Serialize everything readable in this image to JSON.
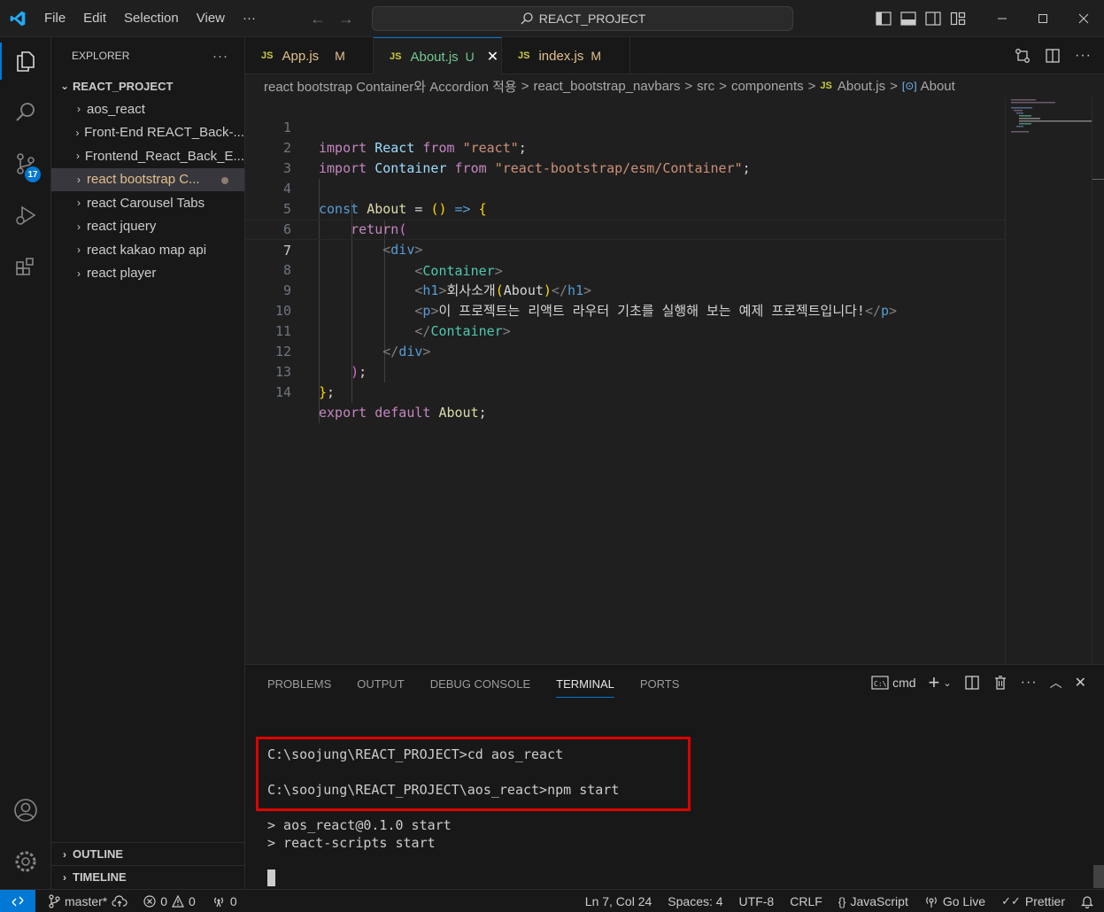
{
  "menu": [
    "File",
    "Edit",
    "Selection",
    "View",
    "···"
  ],
  "command_center": {
    "label": "REACT_PROJECT"
  },
  "explorer": {
    "header": "EXPLORER",
    "more": "···",
    "root": "REACT_PROJECT",
    "items": [
      {
        "label": "aos_react"
      },
      {
        "label": "Front-End REACT_Back-..."
      },
      {
        "label": "Frontend_React_Back_E..."
      },
      {
        "label": "react bootstrap C..."
      },
      {
        "label": "react Carousel Tabs"
      },
      {
        "label": "react jquery"
      },
      {
        "label": "react kakao map api"
      },
      {
        "label": "react player"
      }
    ],
    "outline": "OUTLINE",
    "timeline": "TIMELINE"
  },
  "activity": {
    "scm_badge": "17"
  },
  "tabs": [
    {
      "icon": "JS",
      "label": "App.js",
      "status": "M"
    },
    {
      "icon": "JS",
      "label": "About.js",
      "status": "U"
    },
    {
      "icon": "JS",
      "label": "index.js",
      "status": "M"
    }
  ],
  "breadcrumb": {
    "parts": [
      "react bootstrap Container와 Accordion 적용",
      "react_bootstrap_navbars",
      "src",
      "components"
    ],
    "file_icon": "JS",
    "file": "About.js",
    "symbol": "About",
    "separator": ">"
  },
  "editor": {
    "line_numbers": [
      "1",
      "2",
      "3",
      "4",
      "5",
      "6",
      "7",
      "8",
      "9",
      "10",
      "11",
      "12",
      "13",
      "14"
    ],
    "tokens": {
      "import": "import",
      "from": "from",
      "const": "const",
      "return": "return",
      "export": "export",
      "default": "default",
      "react": "React",
      "react_str": "\"react\"",
      "container": "Container",
      "container_str": "\"react-bootstrap/esm/Container\"",
      "about": "About",
      "eq": " = ",
      "parens": "()",
      "arrow": " => ",
      "lbrace": "{",
      "rbrace": "}",
      "semi": ";",
      "lparen": "(",
      "rparen": ")",
      "div": "div",
      "h1": "h1",
      "p": "p",
      "lt": "<",
      "gt": ">",
      "lt_slash": "</",
      "h1_text": "회사소개",
      "h1_paren_open": "(",
      "h1_about": "About",
      "h1_paren_close": ")",
      "p_text": "이 프로젝트는 리액트 라우터 기초를 실행해 보는 예제 프로젝트입니다!"
    }
  },
  "panel": {
    "tabs": [
      "PROBLEMS",
      "OUTPUT",
      "DEBUG CONSOLE",
      "TERMINAL",
      "PORTS"
    ],
    "shell": "cmd",
    "terminal_lines": [
      "C:\\soojung\\REACT_PROJECT>cd aos_react",
      "C:\\soojung\\REACT_PROJECT\\aos_react>npm start",
      "> aos_react@0.1.0 start",
      "> react-scripts start"
    ]
  },
  "status": {
    "branch": "master*",
    "errors": "0",
    "warnings": "0",
    "ports": "0",
    "position": "Ln 7, Col 24",
    "spaces": "Spaces: 4",
    "encoding": "UTF-8",
    "eol": "CRLF",
    "language": "JavaScript",
    "golive": "Go Live",
    "prettier": "Prettier"
  },
  "colors": {
    "accent": "#0078d4",
    "modified": "#e2c08d",
    "untracked": "#73c991",
    "highlight_box": "#e00000"
  }
}
